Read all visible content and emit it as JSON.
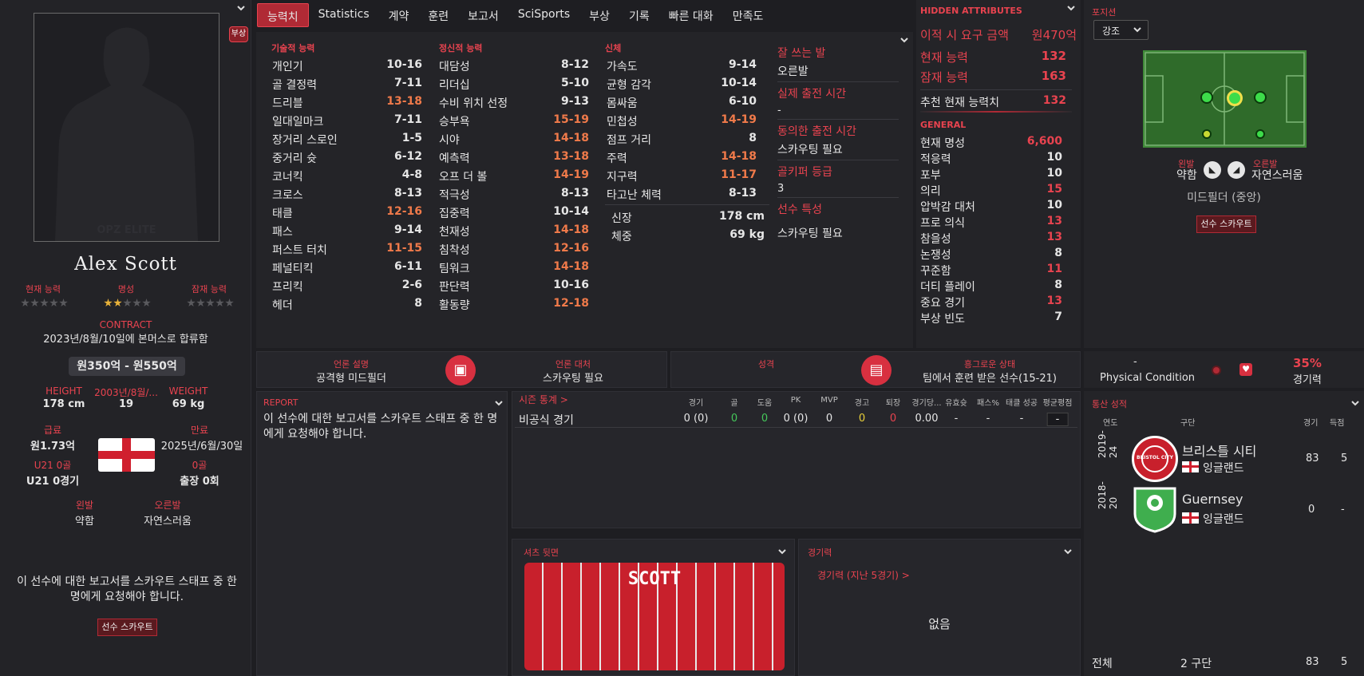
{
  "player": {
    "name": "Alex Scott",
    "ca_label": "현재 능력",
    "rep_label": "명성",
    "pa_label": "잠재 능력",
    "contract_label": "CONTRACT",
    "contract_text": "2023년/8월/10일에 본머스로 합류함",
    "value": "원350억 - 원550억",
    "height_label": "HEIGHT",
    "height": "178 cm",
    "dob_label": "2003년/8월/...",
    "age": "19",
    "weight_label": "WEIGHT",
    "weight": "69 kg",
    "wage_label": "급료",
    "wage": "원1.73억",
    "expires_label": "만료",
    "expires": "2025년/6월/30일",
    "u21_goals_label": "U21 0골",
    "u21_apps": "U21 0경기",
    "goals_label": "0골",
    "apps": "출장 0회",
    "left_foot_label": "왼발",
    "left_foot": "약함",
    "right_foot_label": "오른발",
    "right_foot": "자연스러움",
    "scout_note": "이 선수에 대한 보고서를 스카우트 스태프 중 한 명에게 요청해야 합니다.",
    "scout_btn": "선수 스카우트",
    "injury_badge": "부상",
    "photo_watermark": "OPZ ELITE",
    "rep_stars": 2
  },
  "tabs": [
    "능력치",
    "Statistics",
    "계약",
    "훈련",
    "보고서",
    "SciSports",
    "부상",
    "기록",
    "빠른 대화",
    "만족도"
  ],
  "technical": {
    "title": "기술적 능력",
    "rows": [
      [
        "개인기",
        "10-16",
        false
      ],
      [
        "골 결정력",
        "7-11",
        false
      ],
      [
        "드리블",
        "13-18",
        true
      ],
      [
        "일대일마크",
        "7-11",
        false
      ],
      [
        "장거리 스로인",
        "1-5",
        false
      ],
      [
        "중거리 슛",
        "6-12",
        false
      ],
      [
        "코너킥",
        "4-8",
        false
      ],
      [
        "크로스",
        "8-13",
        false
      ],
      [
        "태클",
        "12-16",
        true
      ],
      [
        "패스",
        "9-14",
        false
      ],
      [
        "퍼스트 터치",
        "11-15",
        true
      ],
      [
        "페널티킥",
        "6-11",
        false
      ],
      [
        "프리킥",
        "2-6",
        false
      ],
      [
        "헤더",
        "8",
        false
      ]
    ]
  },
  "mental": {
    "title": "정신적 능력",
    "rows": [
      [
        "대담성",
        "8-12",
        false
      ],
      [
        "리더십",
        "5-10",
        false
      ],
      [
        "수비 위치 선정",
        "9-13",
        false
      ],
      [
        "승부욕",
        "15-19",
        true
      ],
      [
        "시야",
        "14-18",
        true
      ],
      [
        "예측력",
        "13-18",
        true
      ],
      [
        "오프 더 볼",
        "14-19",
        true
      ],
      [
        "적극성",
        "8-13",
        false
      ],
      [
        "집중력",
        "10-14",
        false
      ],
      [
        "천재성",
        "14-18",
        true
      ],
      [
        "침착성",
        "12-16",
        true
      ],
      [
        "팀워크",
        "14-18",
        true
      ],
      [
        "판단력",
        "10-16",
        false
      ],
      [
        "활동량",
        "12-18",
        true
      ]
    ]
  },
  "physical": {
    "title": "신체",
    "rows": [
      [
        "가속도",
        "9-14",
        false
      ],
      [
        "균형 감각",
        "10-14",
        false
      ],
      [
        "몸싸움",
        "6-10",
        false
      ],
      [
        "민첩성",
        "14-19",
        true
      ],
      [
        "점프 거리",
        "8",
        false
      ],
      [
        "주력",
        "14-18",
        true
      ],
      [
        "지구력",
        "11-17",
        true
      ],
      [
        "타고난 체력",
        "8-13",
        false
      ]
    ],
    "height_label": "신장",
    "height": "178 cm",
    "weight_label": "체중",
    "weight": "69 kg"
  },
  "info": {
    "foot_label": "잘 쓰는 발",
    "foot": "오른발",
    "actual_label": "실제 출전 시간",
    "actual": "-",
    "agreed_label": "동의한 출전 시간",
    "agreed": "스카우팅 필요",
    "gk_label": "골키퍼 등급",
    "gk": "3",
    "traits_label": "선수 특성",
    "traits": "스카우팅 필요"
  },
  "hidden": {
    "title": "HIDDEN ATTRIBUTES",
    "transfer_label": "이적 시 요구 금액",
    "transfer": "원470억",
    "ca_label": "현재 능력",
    "ca": "132",
    "pa_label": "잠재 능력",
    "pa": "163",
    "rec_label": "추천 현재 능력치",
    "rec": "132",
    "general": "GENERAL",
    "rows": [
      [
        "현재 명성",
        "6,600"
      ],
      [
        "적응력",
        "10"
      ],
      [
        "포부",
        "10"
      ],
      [
        "의리",
        "15"
      ],
      [
        "압박감 대처",
        "10"
      ],
      [
        "프로 의식",
        "13"
      ],
      [
        "참을성",
        "13"
      ],
      [
        "논쟁성",
        "8"
      ],
      [
        "꾸준함",
        "11"
      ],
      [
        "더티 플레이",
        "8"
      ],
      [
        "중요 경기",
        "13"
      ],
      [
        "부상 빈도",
        "7"
      ]
    ]
  },
  "position": {
    "title": "포지션",
    "select": "강조",
    "left_label": "왼발",
    "left": "약함",
    "right_label": "오른발",
    "right": "자연스러움",
    "role": "미드필더 (중앙)",
    "scout_btn": "선수 스카우트"
  },
  "media": {
    "desc_label": "언론 설명",
    "desc": "공격형 미드필더",
    "handling_label": "언론 대처",
    "handling": "스카우팅 필요"
  },
  "personality": {
    "label": "성격",
    "happy_label": "흥그로운 상태",
    "happy": "팀에서 훈련 받은 선수(15-21)"
  },
  "condition": {
    "dash": "-",
    "label": "Physical Condition",
    "pct": "35%",
    "sharp": "경기력"
  },
  "report": {
    "title": "REPORT",
    "text": "이 선수에 대한 보고서를 스카우트 스태프 중 한 명에게 요청해야 합니다."
  },
  "season": {
    "title": "시즌 통계 >",
    "cols": [
      "경기",
      "골",
      "도움",
      "PK",
      "MVP",
      "경고",
      "퇴장",
      "경기당...",
      "유효슛",
      "패스%",
      "태클 성공",
      "평균평점"
    ],
    "row_label": "비공식 경기",
    "row": [
      "0 (0)",
      "0",
      "0",
      "0 (0)",
      "0",
      "0",
      "0",
      "0.00",
      "-",
      "-",
      "-",
      "-"
    ]
  },
  "shirt": {
    "title": "셔츠 뒷면",
    "name": "SCOTT"
  },
  "form": {
    "title": "경기력",
    "sub": "경기력 (지난 5경기) >",
    "empty": "없음"
  },
  "career": {
    "title": "통산 성적",
    "col_year": "연도",
    "col_club": "구단",
    "col_apps": "경기",
    "col_goals": "득점",
    "rows": [
      {
        "year": "2019-24",
        "club": "브리스틀 시티",
        "crest": "BRISTOL CITY",
        "nation": "잉글랜드",
        "apps": "83",
        "goals": "5"
      },
      {
        "year": "2018-20",
        "club": "Guernsey",
        "nation": "잉글랜드",
        "apps": "0",
        "goals": "-"
      }
    ],
    "total_label": "전체",
    "total_clubs": "2 구단",
    "total_apps": "83",
    "total_goals": "5"
  }
}
